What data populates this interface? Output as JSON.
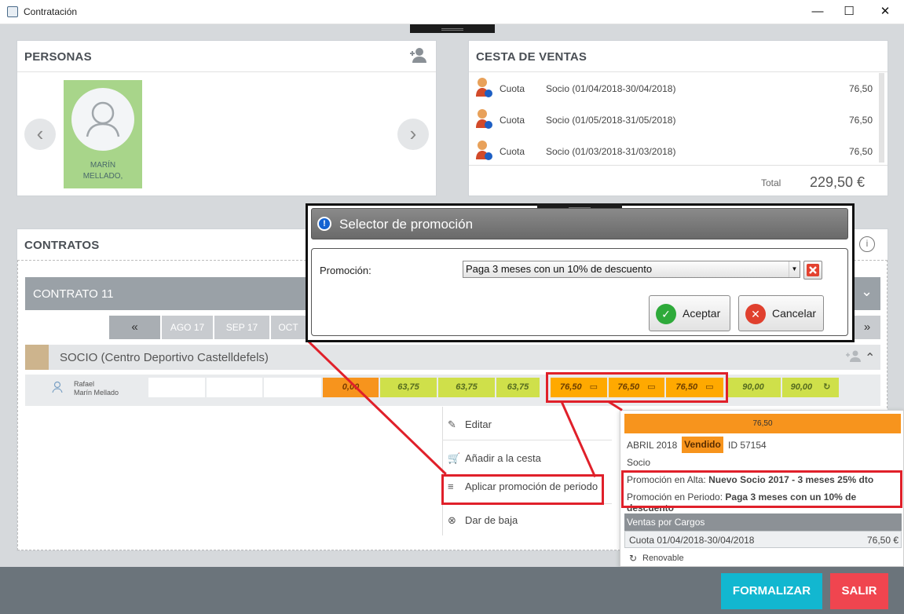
{
  "window": {
    "title": "Contratación",
    "controls": {
      "minimize": "—",
      "maximize": "☐",
      "close": "✕"
    }
  },
  "personas": {
    "title": "PERSONAS",
    "person_name": "MARÍN MELLADO,",
    "add_icon": "add-person-icon"
  },
  "cesta": {
    "title": "CESTA DE VENTAS",
    "items": [
      {
        "type": "Cuota",
        "description": "Socio (01/04/2018-30/04/2018)",
        "amount": "76,50"
      },
      {
        "type": "Cuota",
        "description": "Socio (01/05/2018-31/05/2018)",
        "amount": "76,50"
      },
      {
        "type": "Cuota",
        "description": "Socio (01/03/2018-31/03/2018)",
        "amount": "76,50"
      }
    ],
    "total_label": "Total",
    "total_value": "229,50 €"
  },
  "contratos": {
    "title": "CONTRATOS",
    "contract_name": "CONTRATO 11",
    "months": [
      "«",
      "AGO 17",
      "SEP 17",
      "OCT"
    ],
    "group": "SOCIO (Centro Deportivo Castelldefels)",
    "member": {
      "first": "Rafael",
      "last": "Marín Mellado"
    },
    "cells": [
      "",
      "",
      "",
      "0,00",
      "63,75",
      "63,75",
      "63,75",
      "76,50",
      "76,50",
      "76,50",
      "90,00",
      "90,00"
    ]
  },
  "menu": {
    "items": [
      "Editar",
      "Añadir a la cesta",
      "Aplicar promoción de periodo",
      "Dar de baja"
    ]
  },
  "tooltip": {
    "amount": "76,50",
    "month": "ABRIL 2018",
    "status": "Vendido",
    "id": "ID 57154",
    "concept": "Socio",
    "promo_alta_label": "Promoción en Alta:",
    "promo_alta": "Nuevo Socio 2017 - 3 meses 25% dto",
    "promo_periodo_label": "Promoción en Periodo:",
    "promo_periodo": "Paga 3 meses con un 10% de descuento",
    "ventas_title": "Ventas por Cargos",
    "venta_desc": "Cuota 01/04/2018-30/04/2018",
    "venta_amount": "76,50 €",
    "renovable": "Renovable"
  },
  "dialog": {
    "title": "Selector de promoción",
    "field_label": "Promoción:",
    "selected": "Paga 3 meses con un 10% de descuento",
    "accept": "Aceptar",
    "cancel": "Cancelar"
  },
  "footer": {
    "formalizar": "FORMALIZAR",
    "salir": "SALIR"
  },
  "colors": {
    "green_cell": "#cfe04a",
    "orange_cell": "#f7941d",
    "highlight": "#e0202a",
    "cyan": "#12b7d0",
    "red": "#f0454f"
  }
}
